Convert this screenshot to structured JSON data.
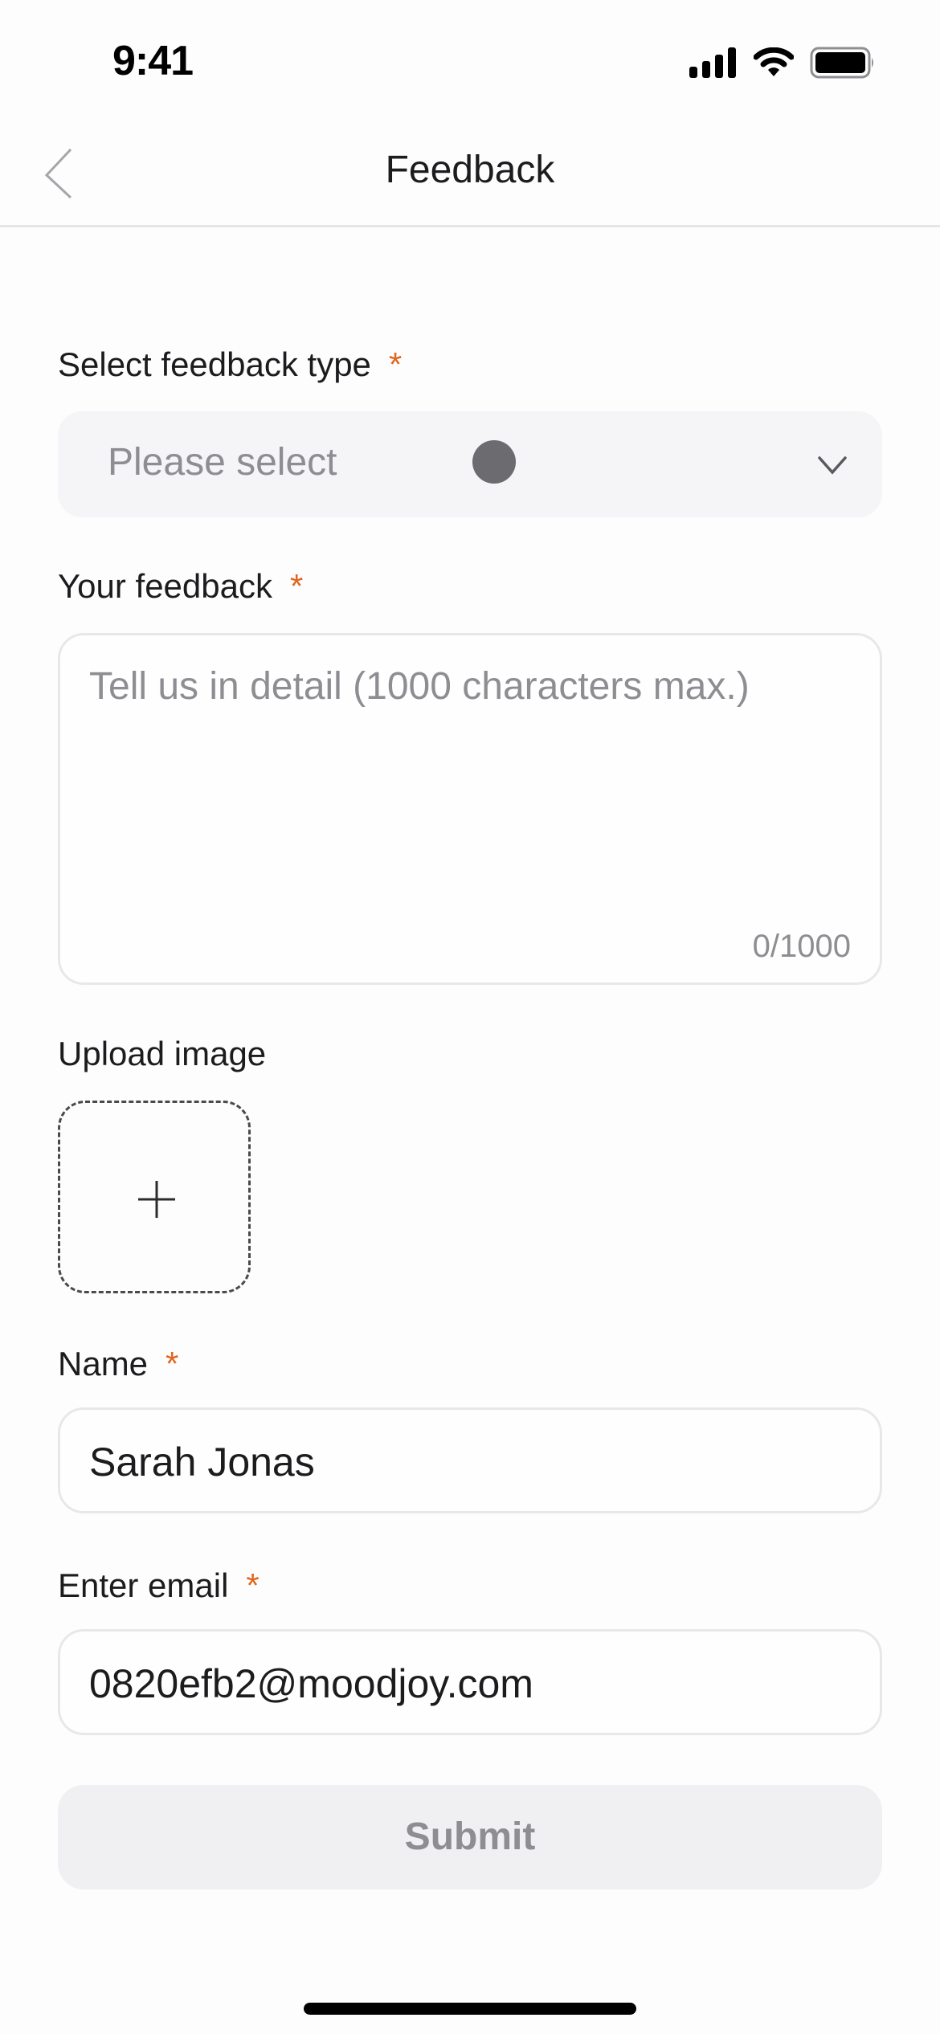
{
  "status_bar": {
    "time": "9:41",
    "icons": [
      "signal-icon",
      "wifi-icon",
      "battery-icon"
    ]
  },
  "nav": {
    "back_icon": "chevron-left-icon",
    "title": "Feedback"
  },
  "form": {
    "required_marker": "*",
    "required_color": "#e0661f",
    "feedback_type": {
      "label": "Select feedback type",
      "placeholder": "Please select",
      "icon": "chevron-down-icon"
    },
    "feedback": {
      "label": "Your feedback",
      "placeholder": "Tell us in detail (1000 characters max.)",
      "value": "",
      "char_count": "0/1000"
    },
    "upload": {
      "label": "Upload image",
      "icon": "plus-icon"
    },
    "name": {
      "label": "Name",
      "value": "Sarah Jonas"
    },
    "email": {
      "label": "Enter email",
      "value": "0820efb2@moodjoy.com"
    },
    "submit_label": "Submit"
  }
}
